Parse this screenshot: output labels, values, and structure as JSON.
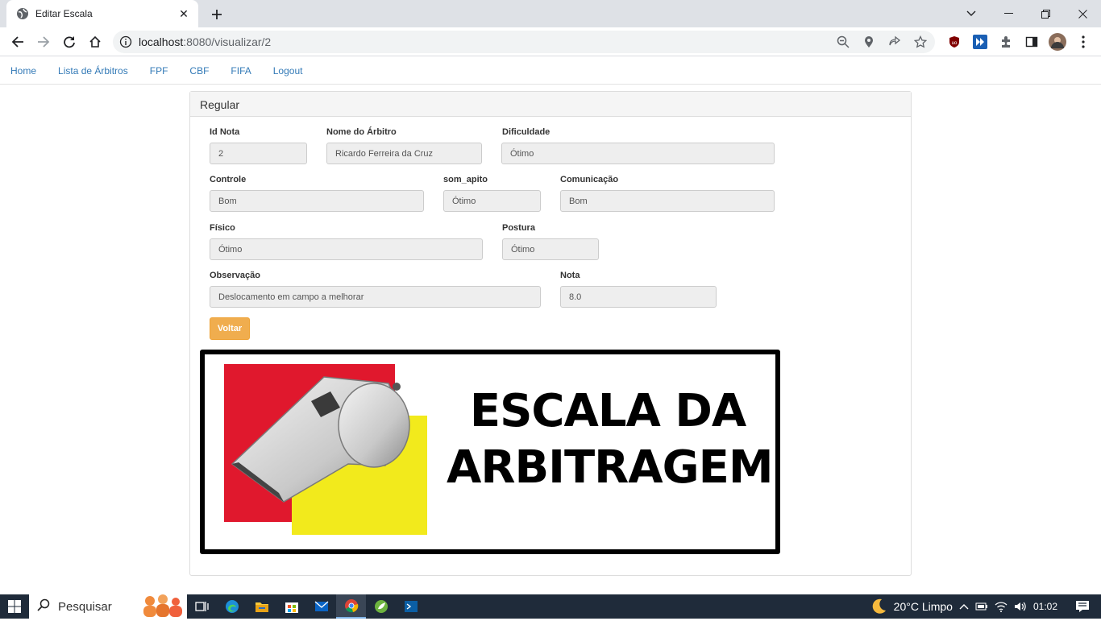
{
  "browser": {
    "tab_title": "Editar Escala",
    "url_host": "localhost",
    "url_path": ":8080/visualizar/2"
  },
  "nav": {
    "items": [
      "Home",
      "Lista de Árbitros",
      "FPF",
      "CBF",
      "FIFA",
      "Logout"
    ]
  },
  "panel": {
    "heading": "Regular"
  },
  "form": {
    "id_nota": {
      "label": "Id Nota",
      "value": "2"
    },
    "nome_arbitro": {
      "label": "Nome do Árbitro",
      "value": "Ricardo Ferreira da Cruz"
    },
    "dificuldade": {
      "label": "Dificuldade",
      "value": "Ótimo"
    },
    "controle": {
      "label": "Controle",
      "value": "Bom"
    },
    "som_apito": {
      "label": "som_apito",
      "value": "Ótimo"
    },
    "comunicacao": {
      "label": "Comunicação",
      "value": "Bom"
    },
    "fisico": {
      "label": "Físico",
      "value": "Ótimo"
    },
    "postura": {
      "label": "Postura",
      "value": "Ótimo"
    },
    "observacao": {
      "label": "Observação",
      "value": "Deslocamento em campo a melhorar"
    },
    "nota": {
      "label": "Nota",
      "value": "8.0"
    }
  },
  "voltar_label": "Voltar",
  "banner": {
    "line1": "ESCALA DA",
    "line2": "ARBITRAGEM"
  },
  "taskbar": {
    "search_placeholder": "Pesquisar",
    "weather": "20°C  Limpo",
    "time": "01:02"
  },
  "colors": {
    "link": "#337ab7",
    "voltar_button": "#f0ad4e",
    "banner_red": "#e0182d",
    "banner_yellow": "#f2ea1c"
  }
}
